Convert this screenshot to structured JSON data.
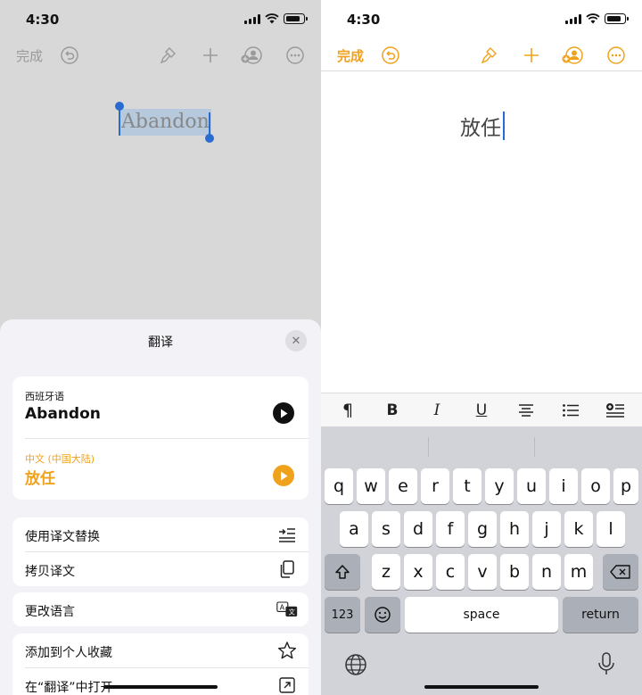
{
  "left_screen": {
    "status": {
      "time": "4:30"
    },
    "toolbar": {
      "done_label": "完成"
    },
    "document": {
      "selected_word": "Abandon"
    },
    "translate_sheet": {
      "title": "翻译",
      "source": {
        "language": "西班牙语",
        "text": "Abandon"
      },
      "target": {
        "language": "中文 (中国大陆)",
        "text": "放任"
      },
      "actions": [
        {
          "label": "使用译文替换"
        },
        {
          "label": "拷贝译文"
        },
        {
          "label": "更改语言"
        },
        {
          "label": "添加到个人收藏"
        },
        {
          "label": "在“翻译”中打开"
        }
      ],
      "accent_color": "#f0a21c"
    }
  },
  "right_screen": {
    "status": {
      "time": "4:30"
    },
    "toolbar": {
      "done_label": "完成",
      "accent_color": "#f0a21c"
    },
    "document": {
      "text": "放任"
    },
    "keyboard": {
      "row1": [
        "q",
        "w",
        "e",
        "r",
        "t",
        "y",
        "u",
        "i",
        "o",
        "p"
      ],
      "row2": [
        "a",
        "s",
        "d",
        "f",
        "g",
        "h",
        "j",
        "k",
        "l"
      ],
      "row3": [
        "z",
        "x",
        "c",
        "v",
        "b",
        "n",
        "m"
      ],
      "numbers_key": "123",
      "space_key": "space",
      "return_key": "return"
    }
  }
}
